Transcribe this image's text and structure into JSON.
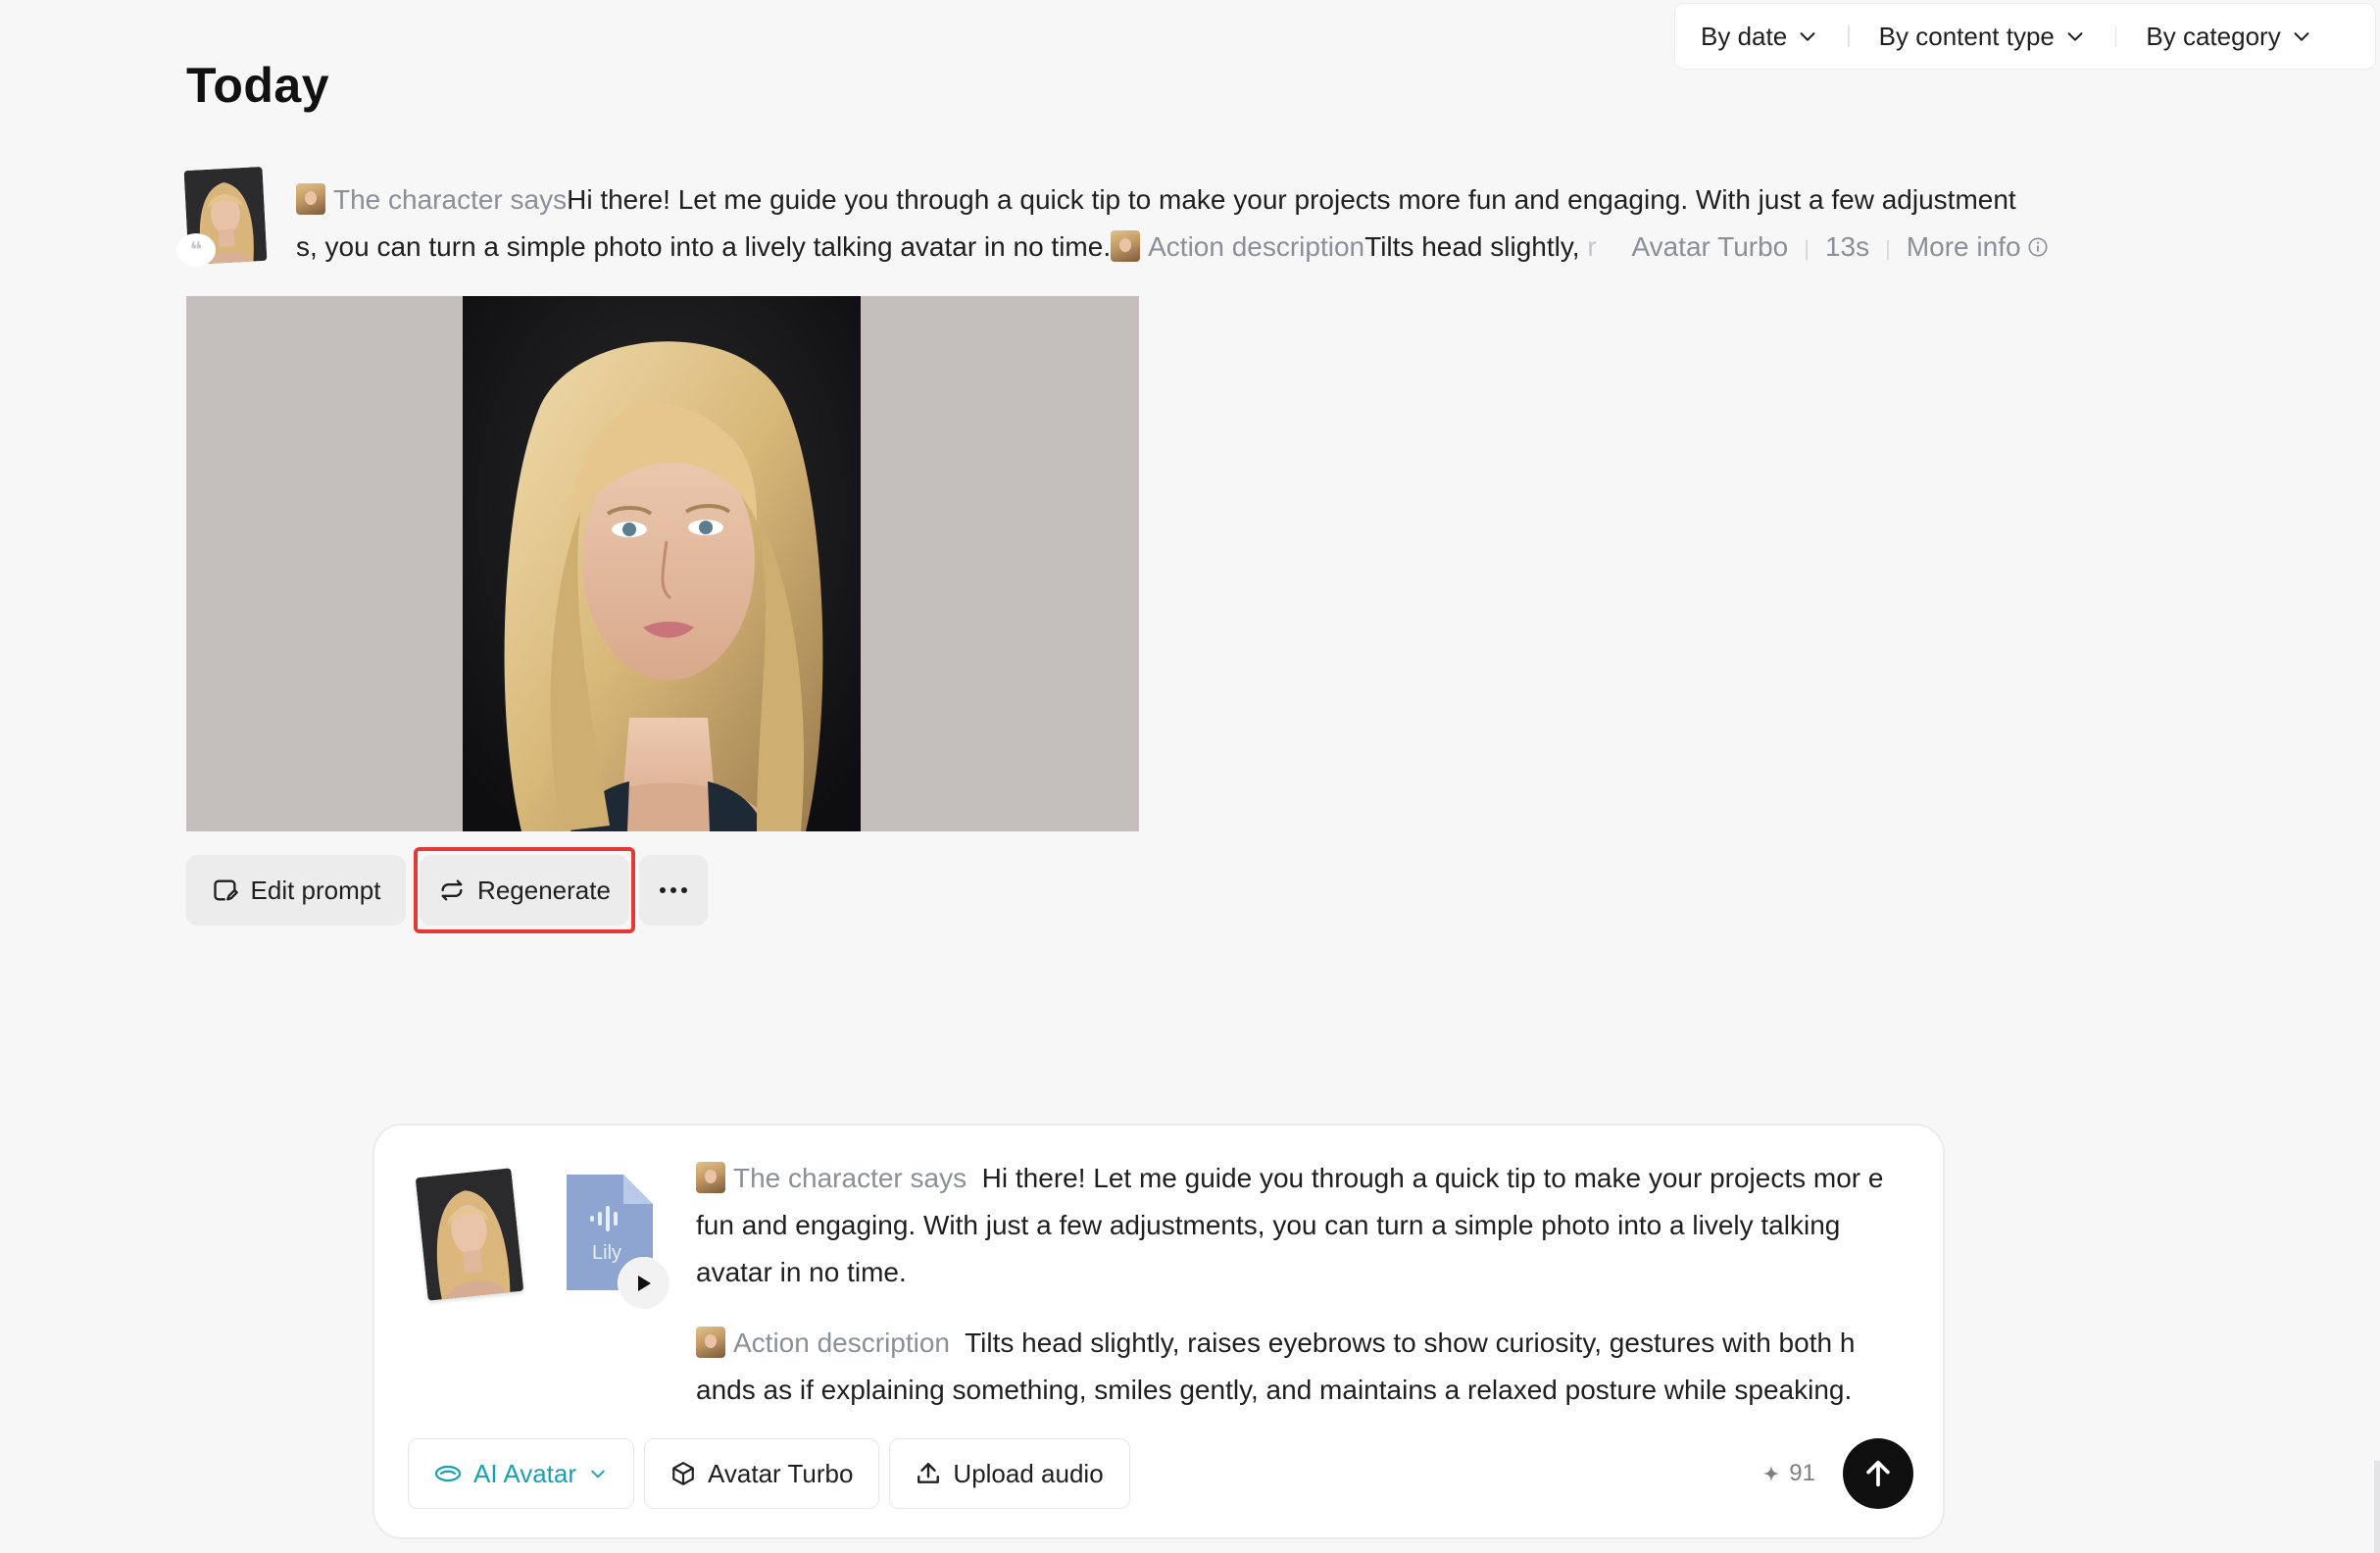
{
  "filters": {
    "by_date": "By date",
    "by_content_type": "By content type",
    "by_category": "By category"
  },
  "section_title": "Today",
  "summary": {
    "quote_glyph": "❝",
    "says_label": "The character says",
    "says_text_line1": "Hi there! Let me guide you through a quick tip to make your projects more fun and engaging. With just a few adjustment",
    "says_text_line2": "s, you can turn a simple photo into a lively talking avatar in no time.",
    "action_label": "Action description",
    "action_text": "Tilts head slightly,",
    "action_text_fade": "r",
    "model": "Avatar Turbo",
    "duration": "13s",
    "more_info": "More info"
  },
  "actions": {
    "edit_prompt": "Edit prompt",
    "regenerate": "Regenerate"
  },
  "composer": {
    "voice_name": "Lily",
    "says_label": "The character says",
    "says_text": "Hi there! Let me guide you through a quick tip to make your projects mor e fun and engaging. With just a few adjustments, you can turn a simple photo into a lively talking avatar in no time.",
    "action_label": "Action description",
    "action_text": "Tilts head slightly, raises eyebrows to show curiosity, gestures with both h ands as if explaining something, smiles gently, and maintains a relaxed posture while speaking.",
    "mode_label": "AI Avatar",
    "model_label": "Avatar Turbo",
    "upload_label": "Upload audio",
    "credits": "91"
  },
  "colors": {
    "accent": "#18a0b4",
    "highlight": "#e53935",
    "send": "#0f0f10"
  }
}
